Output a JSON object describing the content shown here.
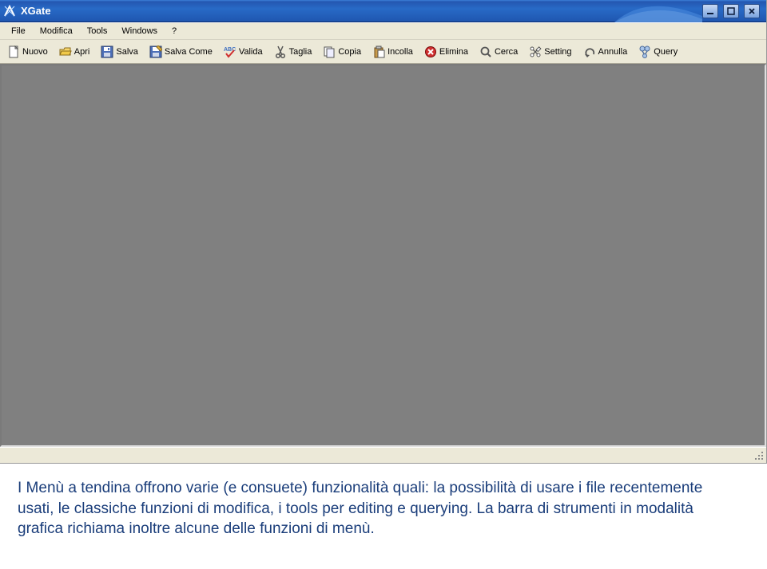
{
  "window": {
    "title": "XGate"
  },
  "menu": {
    "items": [
      "File",
      "Modifica",
      "Tools",
      "Windows",
      "?"
    ]
  },
  "toolbar": {
    "buttons": [
      {
        "label": "Nuovo",
        "icon": "new"
      },
      {
        "label": "Apri",
        "icon": "open"
      },
      {
        "label": "Salva",
        "icon": "save"
      },
      {
        "label": "Salva Come",
        "icon": "saveas"
      },
      {
        "label": "Valida",
        "icon": "validate"
      },
      {
        "label": "Taglia",
        "icon": "cut"
      },
      {
        "label": "Copia",
        "icon": "copy"
      },
      {
        "label": "Incolla",
        "icon": "paste"
      },
      {
        "label": "Elimina",
        "icon": "delete"
      },
      {
        "label": "Cerca",
        "icon": "search"
      },
      {
        "label": "Setting",
        "icon": "settings"
      },
      {
        "label": "Annulla",
        "icon": "undo"
      },
      {
        "label": "Query",
        "icon": "query"
      }
    ]
  },
  "caption": "I Menù a tendina offrono varie (e consuete) funzionalità quali: la possibilità di usare i file recentemente usati, le classiche funzioni di modifica, i tools per editing e querying. La barra di strumenti in modalità grafica richiama inoltre alcune delle funzioni di menù."
}
